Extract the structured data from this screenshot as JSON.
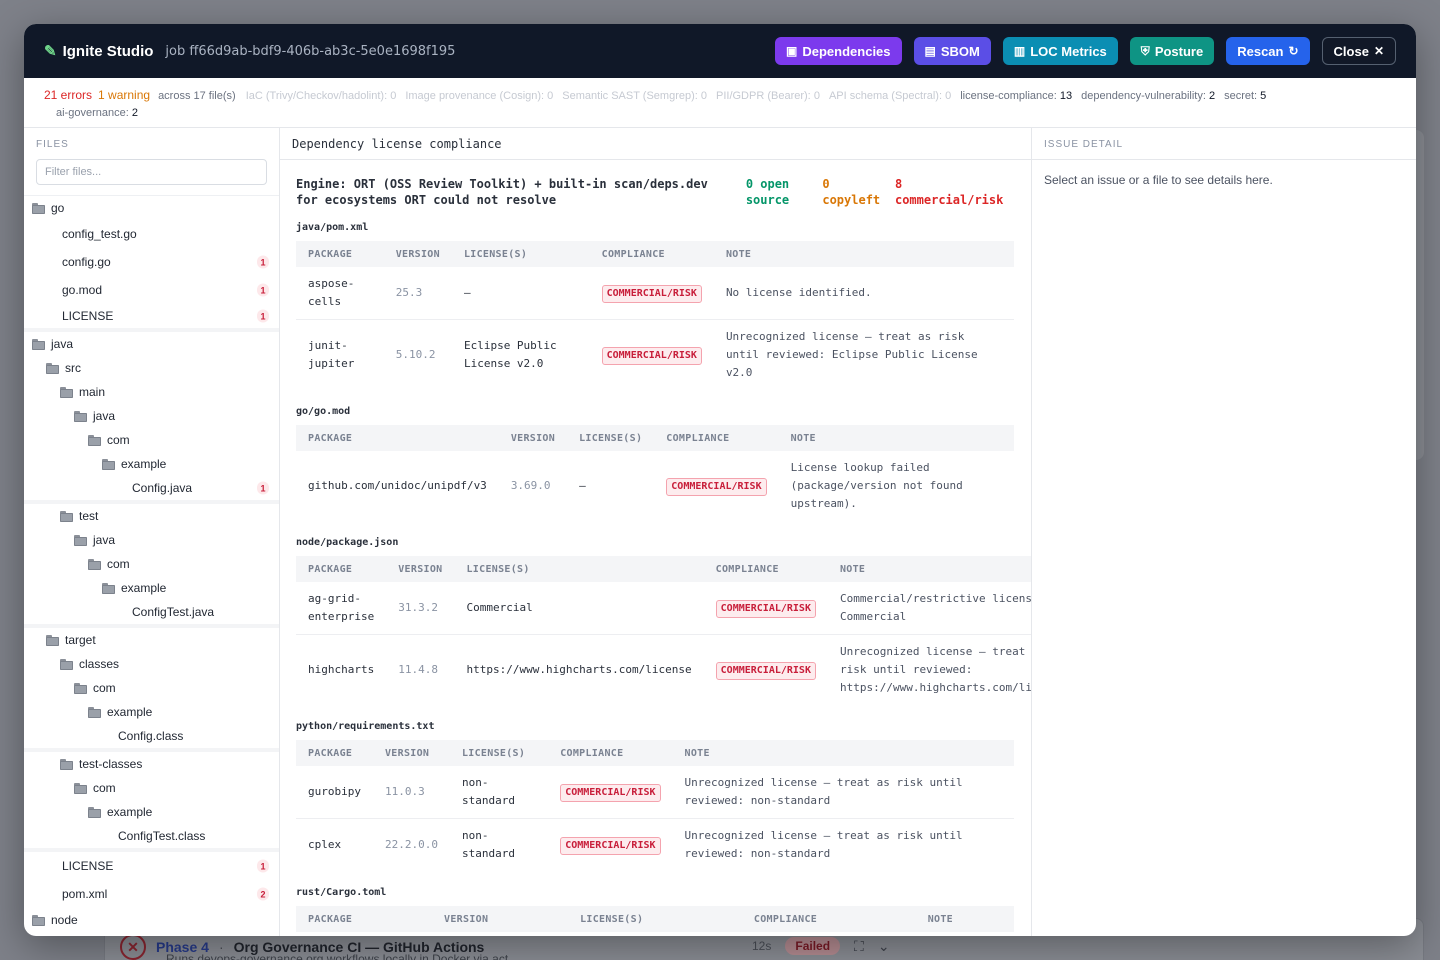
{
  "background": {
    "phase_label": "Phase 4",
    "phase_separator": "·",
    "phase_title": "Org Governance CI — GitHub Actions",
    "phase_subtitle": "Runs devops-governance org workflows locally in Docker via act",
    "duration": "12s",
    "status": "Failed"
  },
  "topbar": {
    "title": "Ignite Studio",
    "job": "job ff66d9ab-bdf9-406b-ab3c-5e0e1698f195",
    "buttons": {
      "dependencies": "Dependencies",
      "sbom": "SBOM",
      "loc": "LOC Metrics",
      "posture": "Posture",
      "rescan": "Rescan",
      "close": "Close"
    }
  },
  "summary": {
    "errors": "21 errors",
    "warnings": "1 warning",
    "across": "across 17 file(s)",
    "chips": [
      {
        "label": "IaC (Trivy/Checkov/hadolint):",
        "count": "0",
        "dim": true
      },
      {
        "label": "Image provenance (Cosign):",
        "count": "0",
        "dim": true
      },
      {
        "label": "Semantic SAST (Semgrep):",
        "count": "0",
        "dim": true
      },
      {
        "label": "PII/GDPR (Bearer):",
        "count": "0",
        "dim": true
      },
      {
        "label": "API schema (Spectral):",
        "count": "0",
        "dim": true
      },
      {
        "label": "license-compliance:",
        "count": "13",
        "dim": false
      },
      {
        "label": "dependency-vulnerability:",
        "count": "2",
        "dim": false
      },
      {
        "label": "secret:",
        "count": "5",
        "dim": false
      },
      {
        "label": "ai-governance:",
        "count": "2",
        "dim": false
      }
    ]
  },
  "files": {
    "heading": "FILES",
    "filter_placeholder": "Filter files...",
    "tree": [
      {
        "name": "go",
        "type": "folder",
        "depth": 0
      },
      {
        "name": "config_test.go",
        "type": "file",
        "depth": 1
      },
      {
        "name": "config.go",
        "type": "file",
        "depth": 1,
        "badge": "1"
      },
      {
        "name": "go.mod",
        "type": "file",
        "depth": 1,
        "badge": "1"
      },
      {
        "name": "LICENSE",
        "type": "file",
        "depth": 1,
        "badge": "1",
        "sep": true
      },
      {
        "name": "java",
        "type": "folder",
        "depth": 0
      },
      {
        "name": "src",
        "type": "folder",
        "depth": 1
      },
      {
        "name": "main",
        "type": "folder",
        "depth": 2
      },
      {
        "name": "java",
        "type": "folder",
        "depth": 3
      },
      {
        "name": "com",
        "type": "folder",
        "depth": 4
      },
      {
        "name": "example",
        "type": "folder",
        "depth": 5
      },
      {
        "name": "Config.java",
        "type": "file",
        "depth": 6,
        "badge": "1",
        "sep": true
      },
      {
        "name": "test",
        "type": "folder",
        "depth": 2
      },
      {
        "name": "java",
        "type": "folder",
        "depth": 3
      },
      {
        "name": "com",
        "type": "folder",
        "depth": 4
      },
      {
        "name": "example",
        "type": "folder",
        "depth": 5
      },
      {
        "name": "ConfigTest.java",
        "type": "file",
        "depth": 6,
        "sep": true
      },
      {
        "name": "target",
        "type": "folder",
        "depth": 1
      },
      {
        "name": "classes",
        "type": "folder",
        "depth": 2
      },
      {
        "name": "com",
        "type": "folder",
        "depth": 3
      },
      {
        "name": "example",
        "type": "folder",
        "depth": 4
      },
      {
        "name": "Config.class",
        "type": "file",
        "depth": 5,
        "sep": true
      },
      {
        "name": "test-classes",
        "type": "folder",
        "depth": 2
      },
      {
        "name": "com",
        "type": "folder",
        "depth": 3
      },
      {
        "name": "example",
        "type": "folder",
        "depth": 4
      },
      {
        "name": "ConfigTest.class",
        "type": "file",
        "depth": 5,
        "sep": true
      },
      {
        "name": "LICENSE",
        "type": "file",
        "depth": 1,
        "badge": "1"
      },
      {
        "name": "pom.xml",
        "type": "file",
        "depth": 1,
        "badge": "2"
      },
      {
        "name": "node",
        "type": "folder",
        "depth": 0
      }
    ]
  },
  "center": {
    "heading": "Dependency license compliance",
    "engine": "Engine: ORT (OSS Review Toolkit) + built-in scan/deps.dev for ecosystems ORT could not resolve",
    "stats": {
      "open_source": "0 open source",
      "copyleft": "0 copyleft",
      "commercial": "8 commercial/risk"
    },
    "columns": [
      "PACKAGE",
      "VERSION",
      "LICENSE(S)",
      "COMPLIANCE",
      "NOTE"
    ],
    "sections": [
      {
        "file": "java/pom.xml",
        "rows": [
          {
            "package": "aspose-cells",
            "version": "25.3",
            "license": "—",
            "compliance": "COMMERCIAL/RISK",
            "note": "No license identified."
          },
          {
            "package": "junit-jupiter",
            "version": "5.10.2",
            "license": "Eclipse Public License v2.0",
            "compliance": "COMMERCIAL/RISK",
            "note": "Unrecognized license — treat as risk until reviewed: Eclipse Public License v2.0"
          }
        ]
      },
      {
        "file": "go/go.mod",
        "rows": [
          {
            "package": "github.com/unidoc/unipdf/v3",
            "version": "3.69.0",
            "license": "—",
            "compliance": "COMMERCIAL/RISK",
            "note": "License lookup failed (package/version not found upstream)."
          }
        ]
      },
      {
        "file": "node/package.json",
        "rows": [
          {
            "package": "ag-grid-enterprise",
            "version": "31.3.2",
            "license": "Commercial",
            "compliance": "COMMERCIAL/RISK",
            "note": "Commercial/restrictive license: Commercial"
          },
          {
            "package": "highcharts",
            "version": "11.4.8",
            "license": "https://www.highcharts.com/license",
            "compliance": "COMMERCIAL/RISK",
            "note": "Unrecognized license — treat as risk until reviewed: https://www.highcharts.com/license"
          }
        ]
      },
      {
        "file": "python/requirements.txt",
        "rows": [
          {
            "package": "gurobipy",
            "version": "11.0.3",
            "license": "non-standard",
            "compliance": "COMMERCIAL/RISK",
            "note": "Unrecognized license — treat as risk until reviewed: non-standard"
          },
          {
            "package": "cplex",
            "version": "22.2.0.0",
            "license": "non-standard",
            "compliance": "COMMERCIAL/RISK",
            "note": "Unrecognized license — treat as risk until reviewed: non-standard"
          }
        ]
      },
      {
        "file": "rust/Cargo.toml",
        "rows": []
      }
    ]
  },
  "detail": {
    "heading": "ISSUE DETAIL",
    "placeholder": "Select an issue or a file to see details here."
  }
}
